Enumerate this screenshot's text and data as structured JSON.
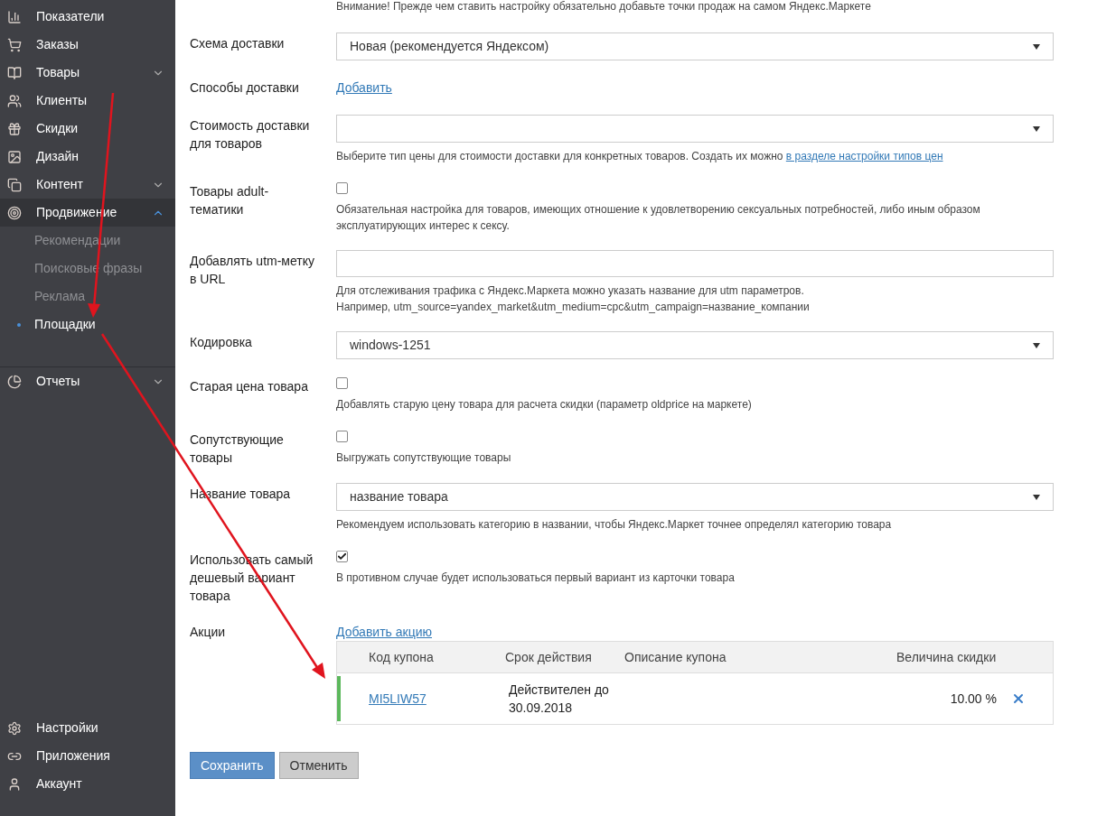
{
  "sidebar": {
    "items": [
      {
        "label": "Показатели",
        "selected": false
      },
      {
        "label": "Заказы",
        "selected": false
      },
      {
        "label": "Товары",
        "selected": false,
        "expanded": false
      },
      {
        "label": "Клиенты",
        "selected": false
      },
      {
        "label": "Скидки",
        "selected": false
      },
      {
        "label": "Дизайн",
        "selected": false
      },
      {
        "label": "Контент",
        "selected": false,
        "expanded": false
      },
      {
        "label": "Продвижение",
        "selected": true,
        "expanded": true,
        "children": [
          {
            "label": "Рекомендации",
            "selected": false
          },
          {
            "label": "Поисковые фразы",
            "selected": false
          },
          {
            "label": "Реклама",
            "selected": false
          },
          {
            "label": "Площадки",
            "selected": true
          }
        ]
      },
      {
        "label": "Отчеты",
        "selected": false,
        "expanded": false
      }
    ],
    "bottom_items": [
      {
        "label": "Настройки"
      },
      {
        "label": "Приложения"
      },
      {
        "label": "Аккаунт"
      }
    ]
  },
  "notice": "Внимание! Прежде чем ставить настройку обязательно добавьте точки продаж на самом Яндекс.Маркете",
  "fields": [
    {
      "kind": "select",
      "label": "Схема доставки",
      "value": "Новая (рекомендуется Яндексом)"
    },
    {
      "kind": "link",
      "label": "Способы доставки",
      "link": "Добавить"
    },
    {
      "kind": "select",
      "label": "Стоимость доставки для товаров",
      "help": "Выберите тип цены для стоимости доставки для конкретных товаров. Создать их можно",
      "help_link": "в разделе настройки типов цен"
    },
    {
      "kind": "checkbox",
      "label": "Товары adult-тематики",
      "checked": false,
      "help": "Обязательная настройка для товаров, имеющих отношение к удовлетворению сексуальных потребностей, либо иным образом эксплуатирующих интерес к сексу."
    },
    {
      "kind": "input",
      "label": "Добавлять utm-метку в URL",
      "help": "Для отслеживания трафика с Яндекс.Маркета можно указать название для utm параметров.",
      "help2": "Например, utm_source=yandex_market&utm_medium=cpc&utm_campaign=название_компании"
    },
    {
      "kind": "select",
      "label": "Кодировка",
      "value": "windows-1251"
    },
    {
      "kind": "checkbox",
      "label": "Старая цена товара",
      "checked": false,
      "help": "Добавлять старую цену товара для расчета скидки (параметр oldprice на маркете)"
    },
    {
      "kind": "checkbox",
      "label": "Сопутствующие товары",
      "checked": false,
      "help": "Выгружать сопутствующие товары"
    },
    {
      "kind": "select",
      "label": "Название товара",
      "value": "название товара",
      "help": "Рекомендуем использовать категорию в названии, чтобы Яндекс.Маркет точнее определял категорию товара"
    },
    {
      "kind": "checkbox",
      "label": "Использовать самый дешевый вариант товара",
      "checked": true,
      "help": "В противном случае будет использоваться первый вариант из карточки товара"
    },
    {
      "kind": "coupons",
      "label": "Акции",
      "link": "Добавить акцию",
      "table": {
        "columns": [
          "Код купона",
          "Срок действия",
          "Описание купона",
          "Величина скидки"
        ],
        "rows": [
          {
            "code": "MI5LIW57",
            "validity": "Действителен до 30.09.2018",
            "discount": "10.00 %",
            "color": "#5cb85c"
          }
        ]
      }
    }
  ],
  "buttons": [
    {
      "label": "Сохранить",
      "kind": "primary"
    },
    {
      "label": "Отменить",
      "kind": "secondary"
    }
  ]
}
